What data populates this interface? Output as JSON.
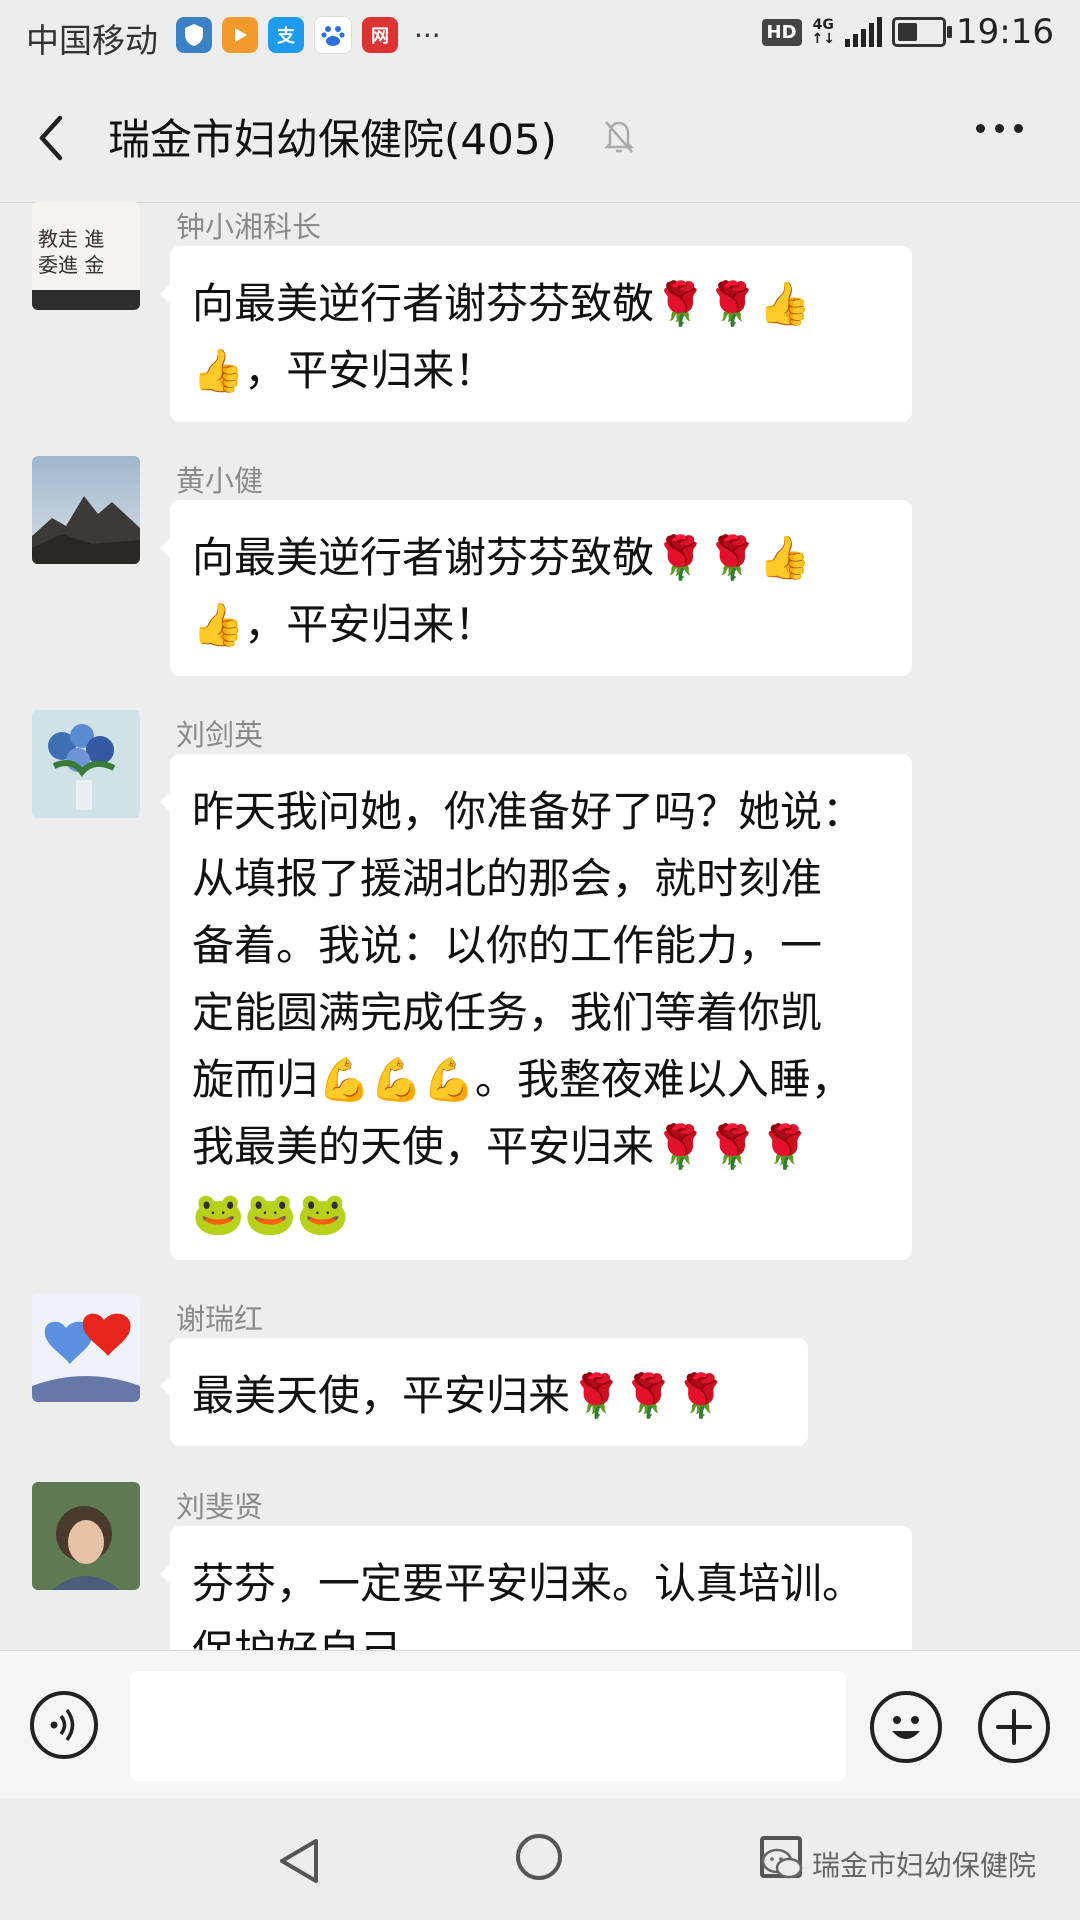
{
  "status_bar": {
    "carrier": "中国移动",
    "hd": "HD",
    "net_top": "4G",
    "net_bottom": "↑↓",
    "time": "19:16",
    "battery_level": 0.4,
    "app_icons": [
      "shield-app-icon",
      "video-app-icon",
      "alipay-icon",
      "baidu-icon",
      "netease-icon"
    ],
    "more": "···"
  },
  "header": {
    "title": "瑞金市妇幼保健院(405)",
    "muted_icon": "bell-off-icon"
  },
  "messages": [
    {
      "sender": "钟小湘科长",
      "text": "向最美逆行者谢芬芬致敬🌹🌹👍\n👍，平安归来！"
    },
    {
      "sender": "黄小健",
      "text": "向最美逆行者谢芬芬致敬🌹🌹👍\n👍，平安归来！"
    },
    {
      "sender": "刘剑英",
      "text": "昨天我问她，你准备好了吗？她说：\n从填报了援湖北的那会，就时刻准\n备着。我说：以你的工作能力，一\n定能圆满完成任务，我们等着你凯\n旋而归💪💪💪。我整夜难以入睡，\n我最美的天使，平安归来🌹🌹🌹\n🐸🐸🐸"
    },
    {
      "sender": "谢瑞红",
      "text": "最美天使，平安归来🌹🌹🌹"
    },
    {
      "sender": "刘斐贤",
      "text": "芬芬，一定要平安归来。认真培训。\n保护好自己。"
    }
  ],
  "input_bar": {
    "voice_icon": "voice-icon",
    "emoji_icon": "emoji-icon",
    "plus_icon": "plus-icon"
  },
  "watermark": {
    "text": "瑞金市妇幼保健院"
  }
}
